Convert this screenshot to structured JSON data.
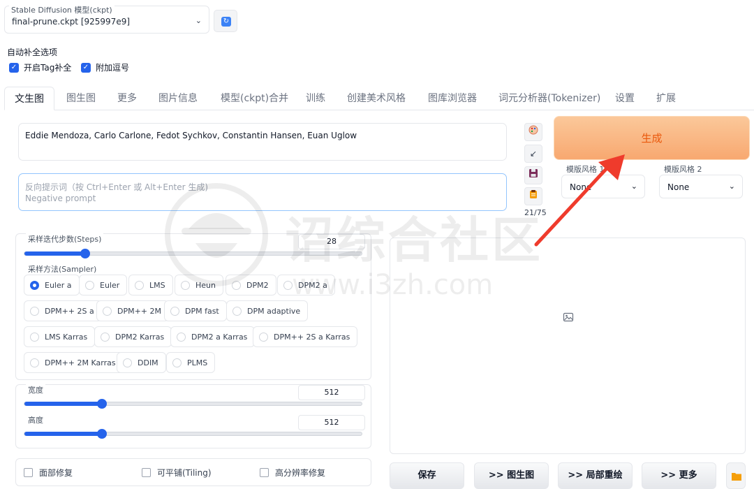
{
  "model": {
    "label": "Stable Diffusion 模型(ckpt)",
    "selected": "final-prune.ckpt [925997e9]"
  },
  "autocomplete": {
    "title": "自动补全选项",
    "enable_tag": "开启Tag补全",
    "add_comma": "附加逗号"
  },
  "tabs": [
    "文生图",
    "图生图",
    "更多",
    "图片信息",
    "模型(ckpt)合并",
    "训练",
    "创建美术风格",
    "图库浏览器",
    "词元分析器(Tokenizer)",
    "设置",
    "扩展"
  ],
  "prompt": {
    "positive": "Eddie Mendoza, Carlo Carlone, Fedot Sychkov, Constantin Hansen, Euan Uglow",
    "negative_placeholder_1": "反向提示词（按 Ctrl+Enter 或 Alt+Enter 生成)",
    "negative_placeholder_2": "Negative prompt",
    "token_count": "21/75"
  },
  "generate": {
    "label": "生成"
  },
  "styles": {
    "style1_label": "模版风格 1",
    "style1_value": "None",
    "style2_label": "模版风格 2",
    "style2_value": "None"
  },
  "steps": {
    "label": "采样迭代步数(Steps)",
    "value": "28",
    "fraction": 0.18
  },
  "sampler": {
    "label": "采样方法(Sampler)",
    "selected": "Euler a",
    "options": [
      "Euler a",
      "Euler",
      "LMS",
      "Heun",
      "DPM2",
      "DPM2 a",
      "DPM++ 2S a",
      "DPM++ 2M",
      "DPM fast",
      "DPM adaptive",
      "LMS Karras",
      "DPM2 Karras",
      "DPM2 a Karras",
      "DPM++ 2S a Karras",
      "DPM++ 2M Karras",
      "DDIM",
      "PLMS"
    ]
  },
  "size": {
    "width_label": "宽度",
    "width_value": "512",
    "width_fraction": 0.23,
    "height_label": "高度",
    "height_value": "512",
    "height_fraction": 0.23
  },
  "options": {
    "face_restore": "面部修复",
    "tiling": "可平铺(Tiling)",
    "hires": "高分辨率修复"
  },
  "output_buttons": {
    "save": "保存",
    "to_img2img": ">> 图生图",
    "to_inpaint": ">> 局部重绘",
    "to_more": ">> 更多"
  },
  "watermark": {
    "text": "诏综合社区",
    "url": "www.i3zh.com"
  },
  "colors": {
    "accent": "#2563eb",
    "generate": "#f8a870",
    "arrow": "#ef3b2c"
  }
}
